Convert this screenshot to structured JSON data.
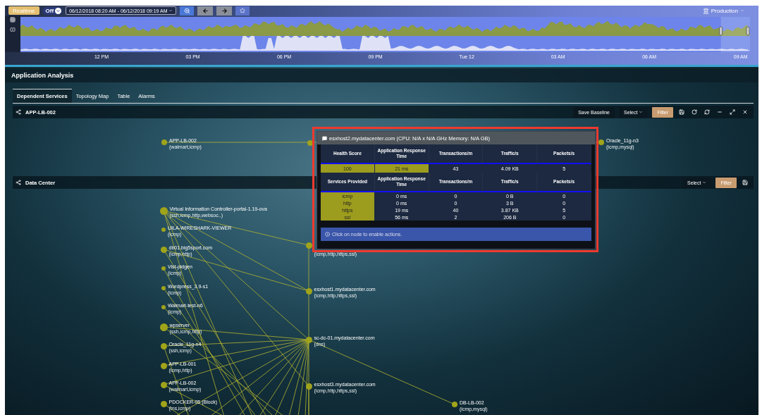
{
  "toolbar": {
    "realtime": "Realtime",
    "refresh_interval": "Off",
    "date_range": "06/12/2018 08:20 AM - 06/12/2018 09:19 AM",
    "environment": "Production"
  },
  "timeline": {
    "axis_labels": [
      "12 PM",
      "03 PM",
      "06 PM",
      "09 PM",
      "Tue 12",
      "03 AM",
      "06 AM",
      "09 AM"
    ]
  },
  "section_title": "Application Analysis",
  "tabs": [
    {
      "label": "Dependent Services",
      "selected": true
    },
    {
      "label": "Topology Map",
      "selected": false
    },
    {
      "label": "Table",
      "selected": false
    },
    {
      "label": "Alarms",
      "selected": false
    }
  ],
  "panels": [
    {
      "title": "APP-LB-002",
      "controls": [
        {
          "kind": "button",
          "label": "Save Baseline"
        },
        {
          "kind": "dropdown",
          "label": "Select"
        },
        {
          "kind": "filter",
          "label": "Filter"
        }
      ],
      "tools": [
        {
          "kind": "save"
        },
        {
          "kind": "rotate"
        },
        {
          "kind": "refresh"
        },
        {
          "kind": "minimize"
        },
        {
          "kind": "expand"
        },
        {
          "kind": "close"
        }
      ],
      "nodes": [
        {
          "kind": "labeled",
          "label": "APP-LB-002",
          "services": "(walmart,icmp)"
        },
        {
          "kind": "covered"
        },
        {
          "kind": "labeled",
          "label": "Oracle_11g-n3",
          "services": "(icmp,mysql)"
        }
      ]
    },
    {
      "title": "Data Center",
      "controls": [
        {
          "kind": "dropdown",
          "label": "Select"
        },
        {
          "kind": "filter",
          "label": "Filter"
        }
      ],
      "tools": [
        {
          "kind": "save"
        }
      ],
      "nodes": [
        {
          "kind": "labeled",
          "label": "Virtual Information Controller-portal-1.19-ova",
          "services": "(ssh,icmp,http,websoc..)"
        },
        {
          "kind": "labeled",
          "label": "UILA-WIRESHARK-VIEWER",
          "services": "(icmp)"
        },
        {
          "kind": "labeled",
          "label": "db01.big5sport.com",
          "services": "(icmp,http)"
        },
        {
          "kind": "labeled",
          "label": "Vist-pktgen",
          "services": "(icmp)"
        },
        {
          "kind": "labeled",
          "label": "Wordpress_3.9-s1",
          "services": "(icmp)"
        },
        {
          "kind": "labeled",
          "label": "Walmart-test-n6",
          "services": "(icmp)"
        },
        {
          "kind": "labeled",
          "label": "wpserver",
          "services": "(ssh,icmp,http)"
        },
        {
          "kind": "labeled",
          "label": "Oracle_11g-n4",
          "services": "(ssh,icmp)"
        },
        {
          "kind": "labeled",
          "label": "APP-LB-001",
          "services": "(icmp,http)"
        },
        {
          "kind": "labeled",
          "label": "APP-LB-002",
          "services": "(walmart,icmp)"
        },
        {
          "kind": "labeled",
          "label": "PDOCKER-05 (Block)",
          "services": "(tns,icmp)"
        },
        {
          "kind": "covered",
          "services": "(icmp,http,https,ssl)"
        },
        {
          "kind": "labeled",
          "label": "esxhost1.mydatacenter.com",
          "services": "(icmp,http,https,ssl)"
        },
        {
          "kind": "labeled",
          "label": "sc-dc-01.mydatacenter.com",
          "services": "(dns)"
        },
        {
          "kind": "labeled",
          "label": "esxhost3.mydatacenter.com",
          "services": "(icmp,http,https,ssl)"
        },
        {
          "kind": "labeled",
          "label": "DB-LB-002",
          "services": "(icmp,mysql)"
        }
      ]
    }
  ],
  "tooltip": {
    "title": "esxhost2.mydatacenter.com (CPU: N/A x N/A GHz Memory: N/A GB)",
    "summary_columns": [
      "Health Score",
      "Application Response Time",
      "Transactions/m",
      "Traffic/s",
      "Packets/s"
    ],
    "summary_row": [
      {
        "text": "100",
        "highlighted": true
      },
      {
        "text": "21 ms",
        "highlighted": true
      },
      {
        "text": "43",
        "highlighted": false
      },
      {
        "text": "4.09 KB",
        "highlighted": false
      },
      {
        "text": "5",
        "highlighted": false
      }
    ],
    "service_columns": [
      "Services Provided",
      "Application Response Time",
      "Transactions/m",
      "Traffic/s",
      "Packets/s"
    ],
    "service_rows": [
      [
        {
          "text": "icmp",
          "highlighted": true
        },
        {
          "text": "0 ms",
          "highlighted": false
        },
        {
          "text": "0",
          "highlighted": false
        },
        {
          "text": "0 B",
          "highlighted": false
        },
        {
          "text": "0",
          "highlighted": false
        }
      ],
      [
        {
          "text": "http",
          "highlighted": true
        },
        {
          "text": "0 ms",
          "highlighted": false
        },
        {
          "text": "0",
          "highlighted": false
        },
        {
          "text": "3 B",
          "highlighted": false
        },
        {
          "text": "0",
          "highlighted": false
        }
      ],
      [
        {
          "text": "https",
          "highlighted": true
        },
        {
          "text": "19 ms",
          "highlighted": false
        },
        {
          "text": "40",
          "highlighted": false
        },
        {
          "text": "3.87 KB",
          "highlighted": false
        },
        {
          "text": "5",
          "highlighted": false
        }
      ],
      [
        {
          "text": "ssl",
          "highlighted": true
        },
        {
          "text": "56 ms",
          "highlighted": false
        },
        {
          "text": "2",
          "highlighted": false
        },
        {
          "text": "206 B",
          "highlighted": false
        },
        {
          "text": "0",
          "highlighted": false
        }
      ]
    ],
    "footer": "Click on node to enable actions."
  }
}
